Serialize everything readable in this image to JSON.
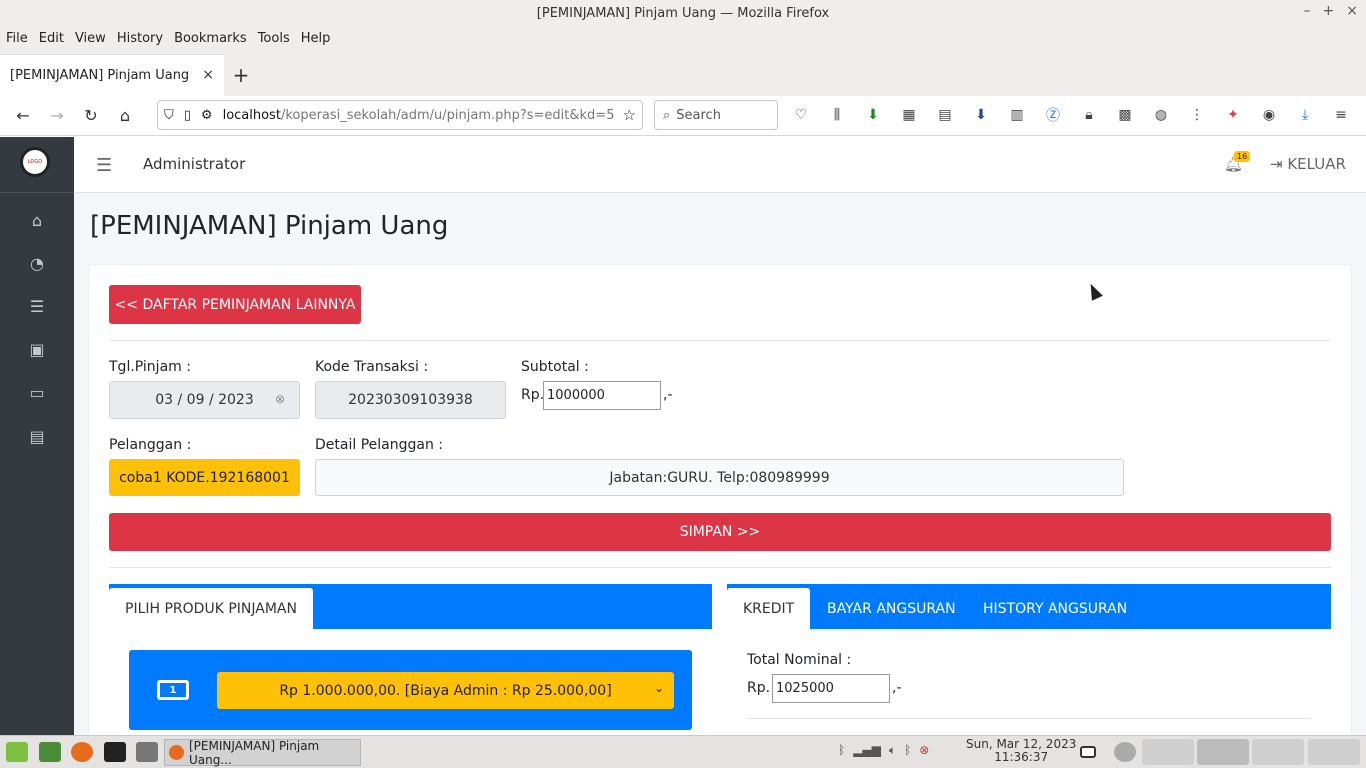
{
  "window": {
    "title": "[PEMINJAMAN] Pinjam Uang — Mozilla Firefox",
    "min": "–",
    "max": "+",
    "close": "×"
  },
  "menu": [
    "File",
    "Edit",
    "View",
    "History",
    "Bookmarks",
    "Tools",
    "Help"
  ],
  "browser_tab": {
    "title": "[PEMINJAMAN] Pinjam Uang",
    "close": "×",
    "new": "+"
  },
  "nav": {
    "back": "←",
    "forward": "→",
    "reload": "↻",
    "home": "⌂",
    "url_host": "localhost",
    "url_path": "/koperasi_sekolah/adm/u/pinjam.php?s=edit&kd=5",
    "search_placeholder": "Search"
  },
  "app": {
    "logo_text": "LOGO",
    "user": "Administrator",
    "notif_count": "16",
    "logout": "KELUAR"
  },
  "page": {
    "title": "[PEMINJAMAN] Pinjam Uang",
    "back_button": "<< DAFTAR PEMINJAMAN LAINNYA",
    "tgl_label": "Tgl.Pinjam :",
    "tgl_value": "03 / 09 / 2023",
    "kode_label": "Kode Transaksi :",
    "kode_value": "20230309103938",
    "subtotal_label": "Subtotal :",
    "rp": "Rp.",
    "subtotal_value": "1000000",
    "suffix": ",-",
    "pelanggan_label": "Pelanggan :",
    "pelanggan_value": "coba1 KODE.192168001",
    "detail_label": "Detail Pelanggan :",
    "detail_value": "Jabatan:GURU. Telp:080989999",
    "save_button": "SIMPAN >>"
  },
  "left_panel": {
    "tab": "PILIH PRODUK PINJAMAN",
    "select_value": "Rp 1.000.000,00. [Biaya Admin : Rp 25.000,00]"
  },
  "right_panel": {
    "tabs": [
      "KREDIT",
      "BAYAR ANGSURAN",
      "HISTORY ANGSURAN"
    ],
    "total_label": "Total Nominal :",
    "total_value": "1025000"
  },
  "taskbar": {
    "task_title": "[PEMINJAMAN] Pinjam Uang...",
    "date": "Sun, Mar 12, 2023",
    "time": "11:36:37"
  }
}
